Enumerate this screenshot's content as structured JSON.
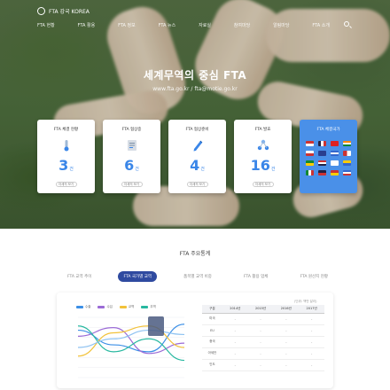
{
  "site": {
    "logo_text": "FTA 강국 KOREA"
  },
  "nav": {
    "items": [
      "FTA 현황",
      "FTA 활용",
      "FTA 정보",
      "FTA 뉴스",
      "자료실",
      "참여마당",
      "알림마당",
      "FTA 소개"
    ]
  },
  "hero": {
    "title": "세계무역의 중심 FTA",
    "subtitle": "www.fta.go.kr / fta@motie.go.kr"
  },
  "cards": [
    {
      "title": "FTA 체결 현황",
      "value": "3",
      "unit": "건",
      "more": "자세히 보기",
      "icon": "thermometer-icon"
    },
    {
      "title": "FTA 협상중",
      "value": "6",
      "unit": "건",
      "more": "자세히 보기",
      "icon": "document-icon"
    },
    {
      "title": "FTA 협상준비",
      "value": "4",
      "unit": "건",
      "more": "자세히 보기",
      "icon": "pen-icon"
    },
    {
      "title": "FTA 발효",
      "value": "16",
      "unit": "건",
      "more": "자세히 보기",
      "icon": "network-icon"
    },
    {
      "title": "FTA 체결국가",
      "icon": "flags-icon"
    }
  ],
  "stats": {
    "section_title": "FTA 주요통계",
    "tabs": [
      "FTA 교역 추이",
      "FTA 국가별 교역",
      "품목별 교역 비중",
      "FTA 활용 업체",
      "FTA 원산지 현황"
    ],
    "active_tab": 1,
    "legend": [
      "수출",
      "수입",
      "교역",
      "무역"
    ],
    "table_note": "(단위: 백만 달러)",
    "table_header": [
      "구분",
      "2014년",
      "2015년",
      "2016년",
      "2017년"
    ],
    "table_rows": [
      [
        "미국",
        "-",
        "-",
        "-",
        "-"
      ],
      [
        "EU",
        "-",
        "-",
        "-",
        "-"
      ],
      [
        "중국",
        "-",
        "-",
        "-",
        "-"
      ],
      [
        "아세안",
        "-",
        "-",
        "-",
        "-"
      ],
      [
        "인도",
        "-",
        "-",
        "-",
        "-"
      ]
    ]
  },
  "colors": {
    "accent": "#3a86e8",
    "active_tab": "#2f4aa0",
    "series": [
      "#3b8fe6",
      "#9b6bd6",
      "#f2c23a",
      "#28b8a0"
    ]
  },
  "chart_data": {
    "type": "line",
    "title": "",
    "x": [
      "1",
      "2",
      "3",
      "4"
    ],
    "series": [
      {
        "name": "수출",
        "values": [
          55,
          38,
          30,
          62
        ]
      },
      {
        "name": "수입",
        "values": [
          48,
          58,
          28,
          40
        ]
      },
      {
        "name": "교역",
        "values": [
          25,
          52,
          60,
          35
        ]
      },
      {
        "name": "무역",
        "values": [
          60,
          30,
          45,
          20
        ]
      },
      {
        "values": [
          35,
          45,
          55,
          50
        ]
      }
    ],
    "ylim": [
      0,
      70
    ],
    "grid": true
  }
}
